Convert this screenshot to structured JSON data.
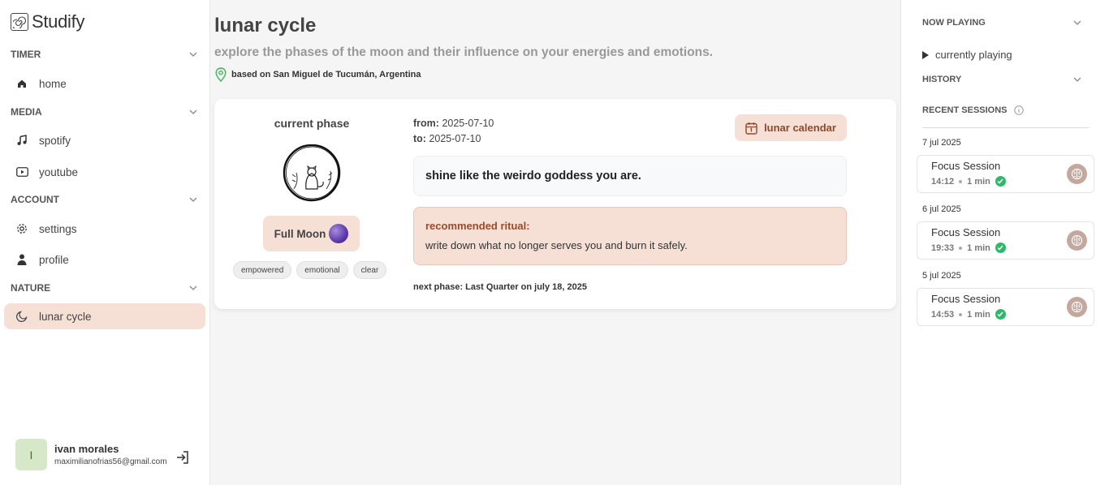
{
  "app": {
    "name": "Studify"
  },
  "sidebar": {
    "sections": [
      {
        "title": "TIMER",
        "items": [
          {
            "label": "home",
            "icon": "home-icon"
          }
        ]
      },
      {
        "title": "MEDIA",
        "items": [
          {
            "label": "spotify",
            "icon": "music-note-icon"
          },
          {
            "label": "youtube",
            "icon": "youtube-icon"
          }
        ]
      },
      {
        "title": "ACCOUNT",
        "items": [
          {
            "label": "settings",
            "icon": "gear-icon"
          },
          {
            "label": "profile",
            "icon": "user-icon"
          }
        ]
      },
      {
        "title": "NATURE",
        "items": [
          {
            "label": "lunar cycle",
            "icon": "moon-icon",
            "active": true
          }
        ]
      }
    ],
    "user": {
      "initial": "I",
      "name": "ivan morales",
      "email": "maximilianofrias56@gmail.com"
    }
  },
  "main": {
    "title": "lunar cycle",
    "subtitle": "explore the phases of the moon and their influence on your energies and emotions.",
    "location": "based on San Miguel de Tucumán, Argentina",
    "card": {
      "phase_label": "current phase",
      "phase_name": "Full Moon",
      "tags": [
        "empowered",
        "emotional",
        "clear"
      ],
      "from_label": "from:",
      "from_value": "2025-07-10",
      "to_label": "to:",
      "to_value": "2025-07-10",
      "calendar_button": "lunar calendar",
      "quote": "shine like the weirdo goddess you are.",
      "ritual_title": "recommended ritual:",
      "ritual_text": "write down what no longer serves you and burn it safely.",
      "next_phase": "next phase: Last Quarter on july 18, 2025"
    }
  },
  "right_panel": {
    "now_playing": "NOW PLAYING",
    "currently_playing": "currently playing",
    "history": "HISTORY",
    "recent_sessions": "RECENT SESSIONS",
    "sessions": [
      {
        "date": "7 jul 2025",
        "title": "Focus Session",
        "time": "14:12",
        "duration": "1 min"
      },
      {
        "date": "6 jul 2025",
        "title": "Focus Session",
        "time": "19:33",
        "duration": "1 min"
      },
      {
        "date": "5 jul 2025",
        "title": "Focus Session",
        "time": "14:53",
        "duration": "1 min"
      }
    ]
  },
  "colors": {
    "accent_bg": "#f6e0d6",
    "accent_text": "#9a4a2a",
    "success": "#2db86a"
  }
}
